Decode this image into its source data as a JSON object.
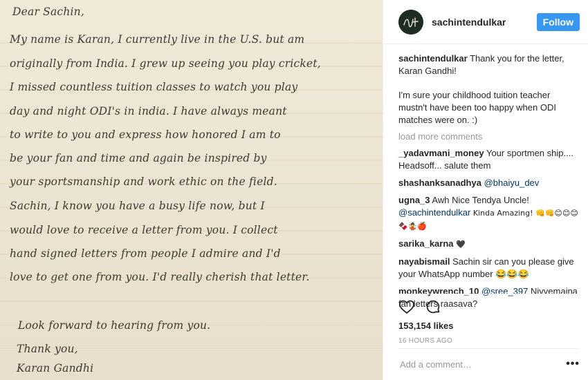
{
  "post": {
    "letter": {
      "lines": [
        "Dear Sachin,",
        "My name is Karan, I currently live in the U.S. but am",
        "originally from India. I grew up seeing you play cricket,",
        "I missed countless tuition classes to watch you play",
        "day and night ODI's in india. I have always meant",
        "to write to you and express how honored I am to",
        "be your fan and time and again be inspired by",
        "your sportsmanship and work ethic on the field.",
        "Sachin, I know you have a busy life now, but I",
        "would love to receive a letter from you. I collect",
        "hand signed letters from people I admire and I'd",
        "love to get one from you. I'd really cherish that letter.",
        "Look forward to hearing from you.",
        "Thank you,",
        "Karan Gandhi"
      ]
    },
    "header": {
      "username": "sachintendulkar",
      "follow_label": "Follow"
    },
    "caption": {
      "username": "sachintendulkar",
      "text_1": "Thank you for the letter, Karan Gandhi!",
      "text_2": "I'm sure your childhood tuition teacher mustn't have been too happy when ODI matches were on. :)"
    },
    "load_more": "load more comments",
    "comments": [
      {
        "user": "_yadavmani_money",
        "text": "Your sportmen ship.... Headsoff... salute them"
      },
      {
        "user": "shashanksanadhya",
        "mention": "@bhaiyu_dev"
      },
      {
        "user": "ugna_3",
        "text": "Awh Nice Tendya Uncle!",
        "mention": "@sachintendulkar",
        "text_after": "Kinda Amazing! 👊👊😊😊😊🍫🤹🍎"
      },
      {
        "user": "sarika_karna",
        "text": "🖤"
      },
      {
        "user": "nayabismail",
        "text": "Sachin sir can you please give your WhatsApp number 😂😂😂"
      },
      {
        "user": "monkeywrench_10",
        "mention": "@sree_397",
        "text": "Nivvemaina fan letters raasava?"
      }
    ],
    "likes": "153,154 likes",
    "time": "16 HOURS AGO",
    "add_comment_placeholder": "Add a comment…",
    "more_options": "•••",
    "icons": {
      "like": "heart-icon",
      "comment": "comment-bubble-icon",
      "more": "more-options-icon"
    },
    "colors": {
      "follow_button": "#3897f0",
      "mention": "#003569",
      "muted": "#999999",
      "paper": "#efe6d2"
    }
  }
}
